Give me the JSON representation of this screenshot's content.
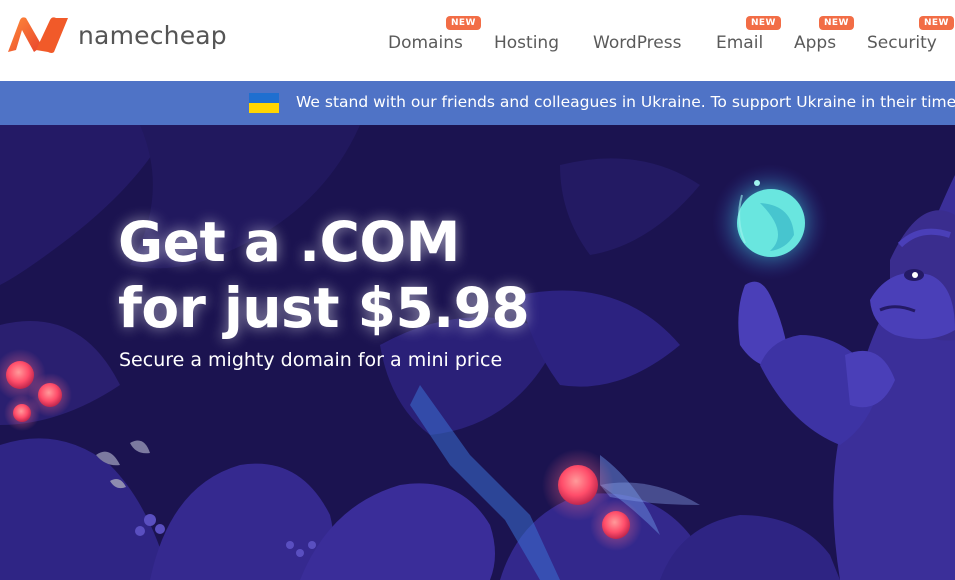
{
  "brand": {
    "name": "namecheap",
    "color": "#f26d46"
  },
  "nav": [
    {
      "label": "Domains",
      "badge": "NEW"
    },
    {
      "label": "Hosting",
      "badge": ""
    },
    {
      "label": "WordPress",
      "badge": ""
    },
    {
      "label": "Email",
      "badge": "NEW"
    },
    {
      "label": "Apps",
      "badge": "NEW"
    },
    {
      "label": "Security",
      "badge": "NEW"
    }
  ],
  "banner": {
    "text": "We stand with our friends and colleagues in Ukraine. To support Ukraine in their time of ne",
    "flag_colors": [
      "#1f6fd0",
      "#ffd500"
    ],
    "background": "#4f73c6"
  },
  "hero": {
    "title_line1": "Get a .COM",
    "title_line2": "for just $5.98",
    "subtitle": "Secure a mighty domain for a mini price",
    "background": "#1b1350"
  }
}
